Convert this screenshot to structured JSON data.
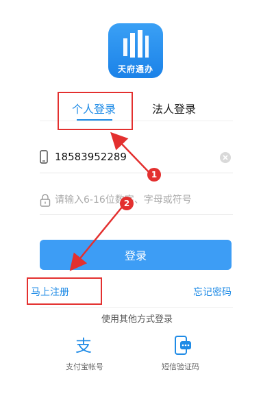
{
  "app": {
    "logo_text": "天府通办"
  },
  "tabs": {
    "personal_label": "个人登录",
    "legal_label": "法人登录"
  },
  "form": {
    "phone_value": "18583952289",
    "password_placeholder": "请输入6-16位数字、字母或符号",
    "login_label": "登录"
  },
  "links": {
    "register_label": "马上注册",
    "forgot_label": "忘记密码"
  },
  "other_methods": {
    "title": "使用其他方式登录",
    "alipay_label": "支付宝帐号",
    "sms_label": "短信验证码"
  },
  "annotations": {
    "badge_1": "1",
    "badge_2": "2",
    "color": "#e3302f"
  },
  "colors": {
    "accent": "#1f8be6",
    "button": "#3d9df5"
  },
  "icons": {
    "logo": "tianfu-logo-icon",
    "phone": "phone-icon",
    "clear": "clear-icon",
    "lock": "lock-icon",
    "alipay": "alipay-icon",
    "sms": "sms-icon"
  }
}
